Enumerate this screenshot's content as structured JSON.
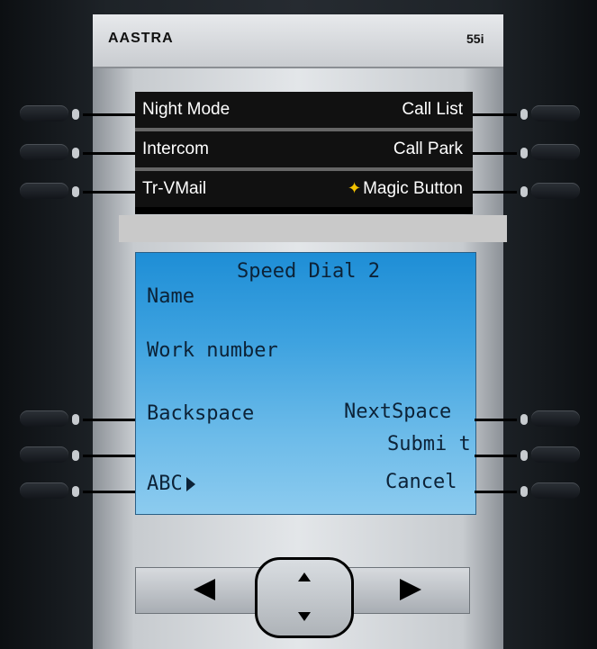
{
  "device": {
    "brand": "AASTRA",
    "model": "55i"
  },
  "softkeys": {
    "left": [
      "Night Mode",
      "Intercom",
      "Tr-VMail"
    ],
    "right": [
      "Call List",
      "Call Park",
      "Magic Button"
    ]
  },
  "screen": {
    "title": "Speed Dial 2",
    "field1": "Name",
    "field2": "Work number",
    "backspace": "Backspace",
    "nextspace": "NextSpace",
    "submit": "Submi t",
    "abc": "ABC",
    "cancel": "Cancel"
  },
  "colors": {
    "lcd_blue": "#3fa3e0",
    "bezel_dark": "#1e2328",
    "magic_star": "#f2c200"
  }
}
